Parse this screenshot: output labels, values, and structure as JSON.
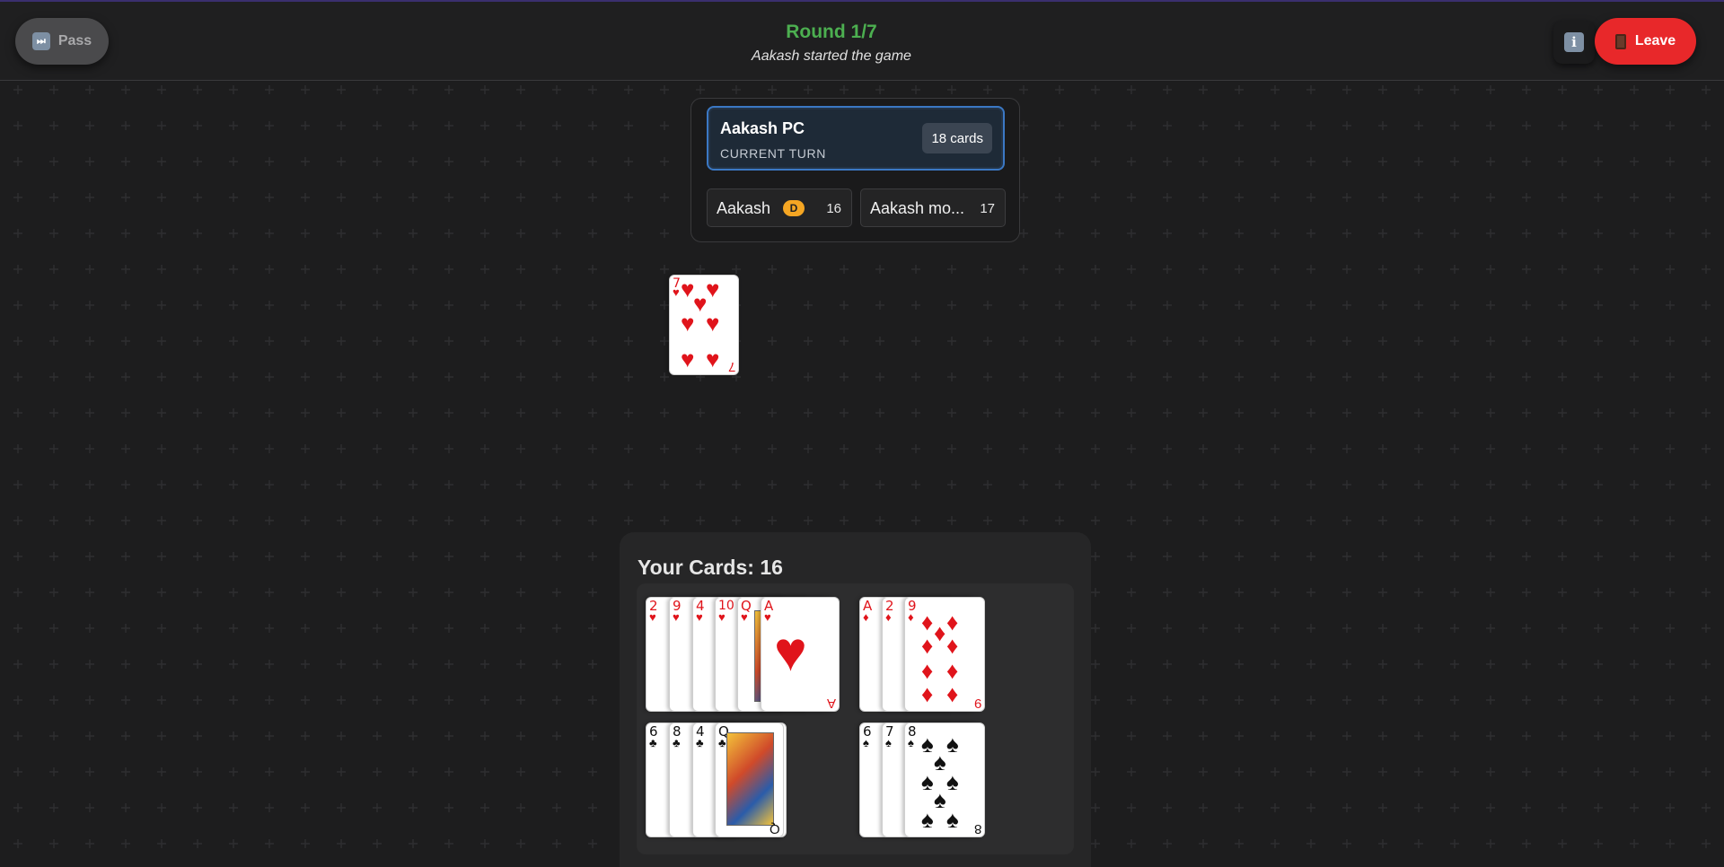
{
  "header": {
    "pass_label": "Pass",
    "pass_icon": "fast-forward-icon",
    "round": "Round 1/7",
    "status": "Aakash started the game",
    "info_icon": "info-icon",
    "leave_label": "Leave",
    "leave_icon": "door-icon"
  },
  "players": {
    "current": {
      "name": "Aakash PC",
      "label": "CURRENT TURN",
      "cards": "18 cards"
    },
    "others": [
      {
        "name": "Aakash",
        "badge": "D",
        "count": "16"
      },
      {
        "name": "Aakash mo...",
        "count": "17"
      }
    ]
  },
  "table": {
    "played_card": {
      "rank": "7",
      "suit": "hearts"
    }
  },
  "hand": {
    "title": "Your Cards: 16",
    "groups": [
      {
        "suit": "hearts",
        "cards": [
          "2",
          "9",
          "4",
          "10",
          "Q",
          "A"
        ]
      },
      {
        "suit": "diamonds",
        "cards": [
          "A",
          "2",
          "9"
        ]
      },
      {
        "suit": "clubs",
        "cards": [
          "6",
          "8",
          "4",
          "Q"
        ]
      },
      {
        "suit": "spades",
        "cards": [
          "6",
          "7",
          "8"
        ]
      }
    ]
  },
  "colors": {
    "accent_green": "#4caf50",
    "leave_red": "#e8282a",
    "turn_blue": "#3b78c4",
    "dealer_badge": "#f5a623"
  }
}
